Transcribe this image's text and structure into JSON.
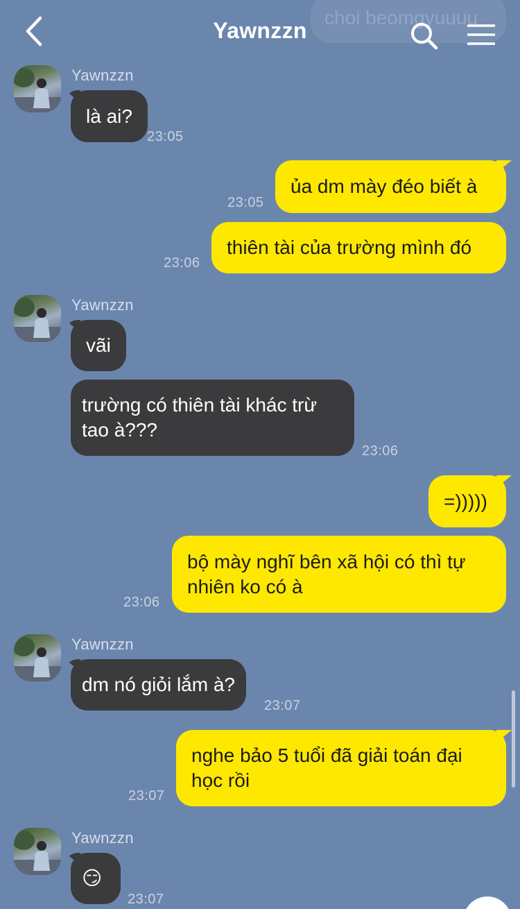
{
  "header": {
    "title": "Yawnzzn",
    "ghost_message": "choi beomgyuuuu"
  },
  "icons": {
    "back": "chevron-left-icon",
    "search": "search-icon",
    "menu": "hamburger-menu-icon"
  },
  "colors": {
    "background": "#6b86ad",
    "incoming_bubble": "#3b3b3d",
    "outgoing_bubble": "#ffe800"
  },
  "messages": [
    {
      "sender": "Yawnzzn",
      "text": "là ai?",
      "time": "23:05"
    },
    {
      "text": "ủa dm mày đéo biết à",
      "time": "23:05"
    },
    {
      "text": "thiên tài của trường mình đó",
      "time": "23:06"
    },
    {
      "sender": "Yawnzzn",
      "text": "vãi"
    },
    {
      "text": "trường có thiên tài khác trừ tao à???",
      "time": "23:06"
    },
    {
      "text": "=)))))"
    },
    {
      "text": "bộ mày nghĩ bên xã hội có thì tự nhiên ko có à",
      "time": "23:06"
    },
    {
      "sender": "Yawnzzn",
      "text": "dm nó giỏi lắm à?",
      "time": "23:07"
    },
    {
      "text": "nghe bảo 5 tuổi đã giải toán đại học rồi",
      "time": "23:07"
    },
    {
      "sender": "Yawnzzn",
      "text": "😏",
      "time": "23:07"
    }
  ]
}
